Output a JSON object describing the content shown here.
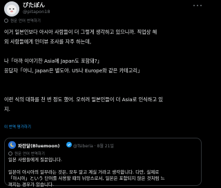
{
  "author": {
    "display_name": "ぴたぽん",
    "handle": "@pitapon18"
  },
  "translation_label": "원문 언어 번역하기",
  "body_lines": [
    "이거 일본인보다 아시아 사람들이 더 그렇게 생각하고 있으니까. 직업상 해",
    "외 사람들에게 인터뷰 조사를 자주 하는데,",
    "",
    "나「아까 이야기한 Asia에 Japan도 포함돼?」",
    "응답자「아니, Japan은 별도야. US나 Europe와 같은 카테고리」",
    "",
    "이런 식의 대화를 천 번 정도 했어. 오히려 일본인들이 더 Asia로 인식하고 있",
    "지."
  ],
  "rate_translation": "이 번역 평가하기",
  "quote": {
    "display_name": "파란달(Bluemoon)",
    "handle": "@Tsiberia",
    "date": "8월 21일",
    "translation_label": "원문 언어 번역하기",
    "lines": [
      "일본 사람들에게 질문입니다.",
      "",
      "일본이 아시아의 일부라는 것은, 모두 알고 계실 거라고 생각합니다. 다만, 실제로",
      "「아시아」という 단어를 사용할 때의 뉘앙스로서, 일본은 포함되지 않은 것처럼 느",
      "껴지는 경우가 있습니다."
    ]
  },
  "colors": {
    "background": "#000000",
    "text": "#e7e9ea",
    "muted": "#71767b",
    "link": "#1d9bf0",
    "border": "#2f3336"
  }
}
